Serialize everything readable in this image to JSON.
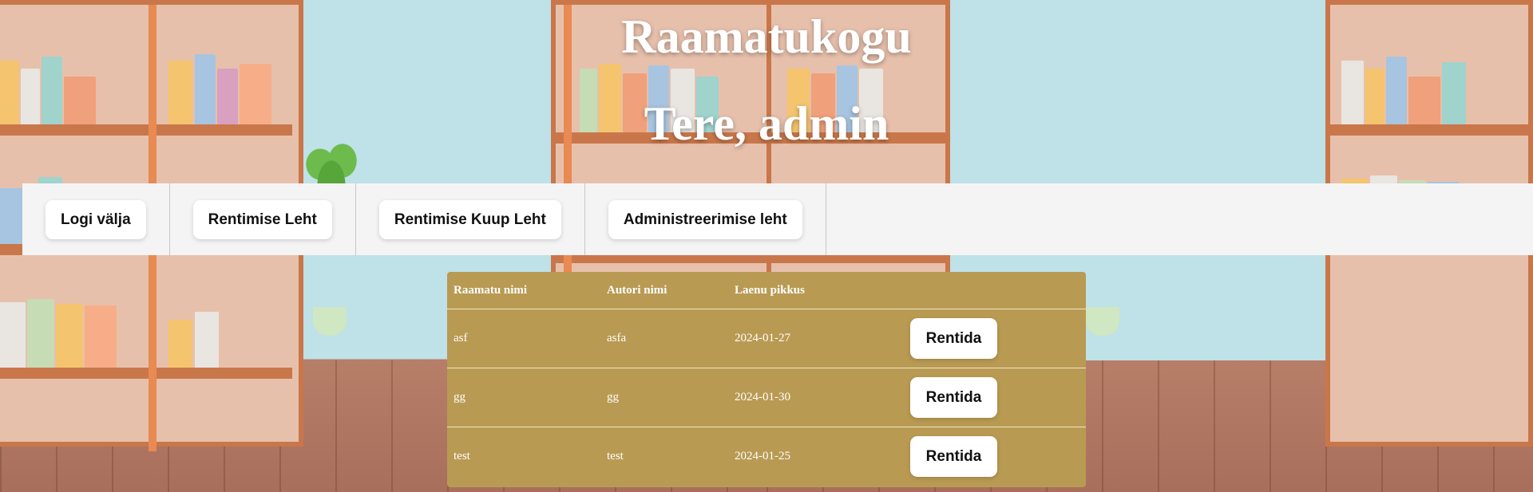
{
  "header": {
    "title": "Raamatukogu",
    "greeting": "Tere, admin"
  },
  "nav": {
    "items": [
      {
        "label": "Logi välja"
      },
      {
        "label": "Rentimise Leht"
      },
      {
        "label": "Rentimise Kuup Leht"
      },
      {
        "label": "Administreerimise leht"
      }
    ]
  },
  "table": {
    "headers": [
      "Raamatu nimi",
      "Autori nimi",
      "Laenu pikkus",
      ""
    ],
    "rows": [
      {
        "book": "asf",
        "author": "asfa",
        "loan": "2024-01-27",
        "action": "Rentida"
      },
      {
        "book": "gg",
        "author": "gg",
        "loan": "2024-01-30",
        "action": "Rentida"
      },
      {
        "book": "test",
        "author": "test",
        "loan": "2024-01-25",
        "action": "Rentida"
      }
    ]
  },
  "colors": {
    "table_background": "#b99a53",
    "nav_background": "#f4f4f4",
    "button_background": "#ffffff",
    "sky": "#bfe1e8",
    "floor": "#b77e68"
  },
  "background": {
    "icon": "library-bookshelves-illustration"
  }
}
